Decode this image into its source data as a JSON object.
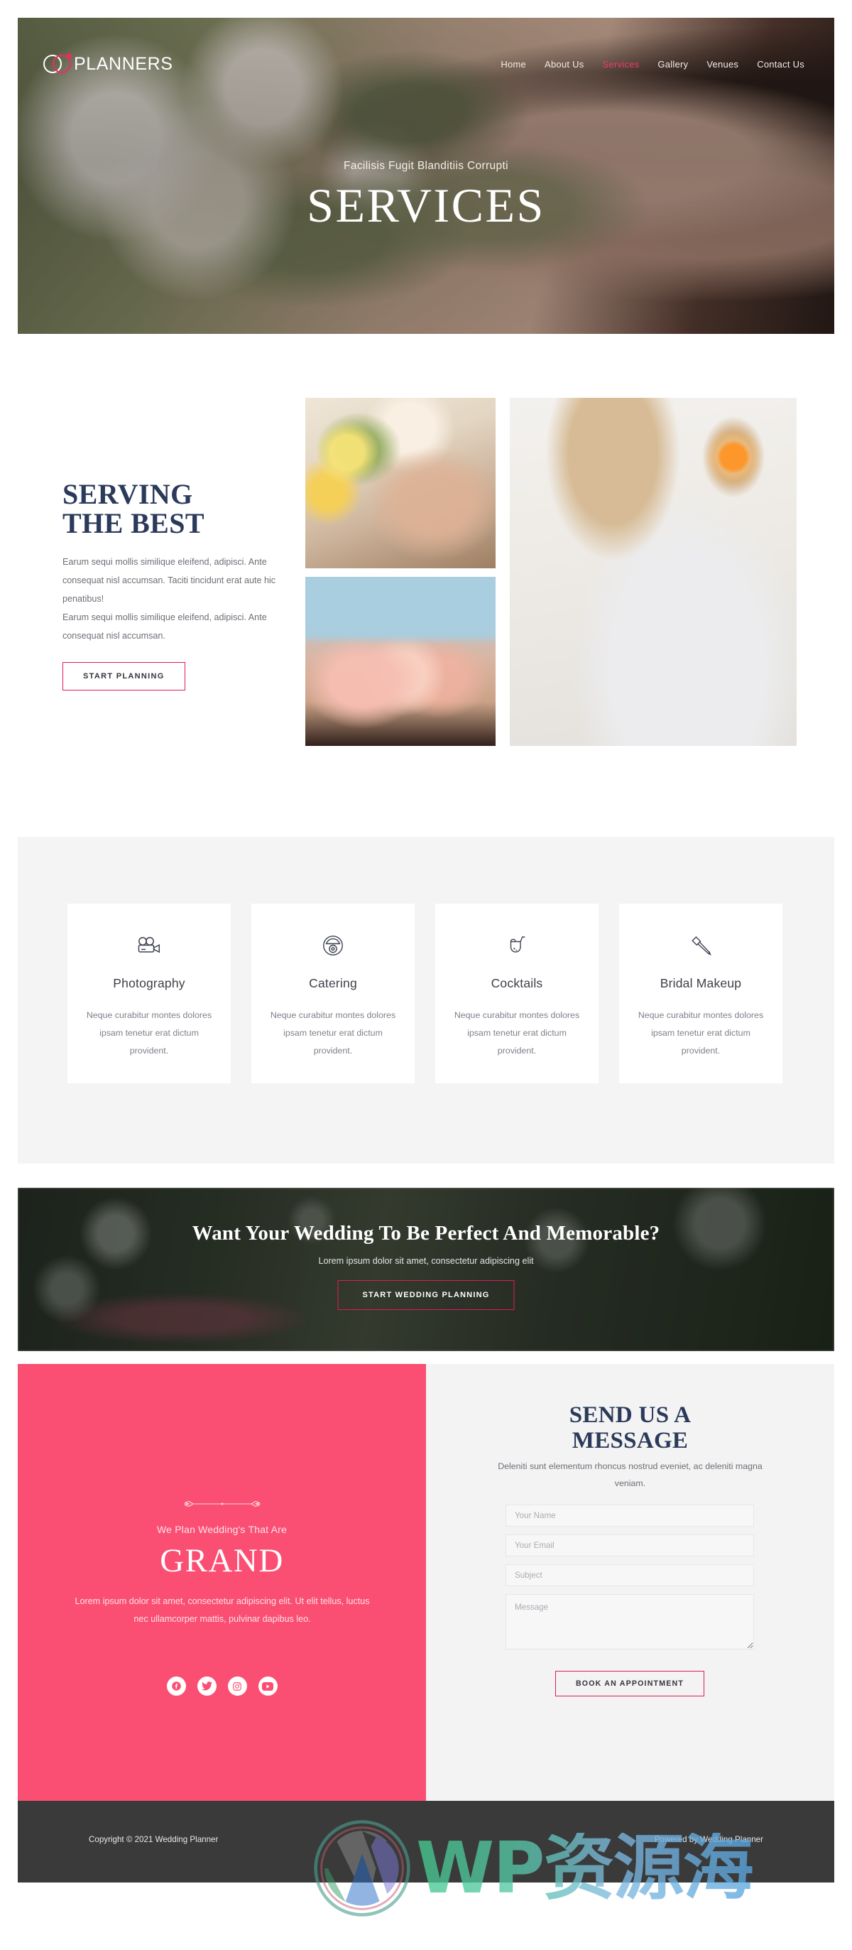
{
  "header": {
    "logo_text": "PLANNERS",
    "nav": [
      {
        "label": "Home",
        "active": false
      },
      {
        "label": "About Us",
        "active": false
      },
      {
        "label": "Services",
        "active": true
      },
      {
        "label": "Gallery",
        "active": false
      },
      {
        "label": "Venues",
        "active": false
      },
      {
        "label": "Contact Us",
        "active": false
      }
    ]
  },
  "hero": {
    "subtitle": "Facilisis Fugit Blanditiis Corrupti",
    "title": "SERVICES"
  },
  "serving": {
    "title_line1": "SERVING",
    "title_line2": "THE BEST",
    "paragraph": "Earum sequi mollis similique eleifend, adipisci. Ante consequat nisl accumsan. Taciti tincidunt erat aute hic penatibus!\nEarum sequi mollis similique eleifend, adipisci. Ante consequat nisl accumsan.",
    "button_label": "START PLANNING"
  },
  "services": {
    "cards": [
      {
        "icon": "video-camera-icon",
        "title": "Photography",
        "description": "Neque curabitur montes dolores ipsam tenetur erat dictum provident."
      },
      {
        "icon": "cloche-food-cover-icon",
        "title": "Catering",
        "description": "Neque curabitur montes dolores ipsam tenetur erat dictum provident."
      },
      {
        "icon": "cocktail-glass-icon",
        "title": "Cocktails",
        "description": "Neque curabitur montes dolores ipsam tenetur erat dictum provident."
      },
      {
        "icon": "makeup-brush-icon",
        "title": "Bridal Makeup",
        "description": "Neque curabitur montes dolores ipsam tenetur erat dictum provident."
      }
    ]
  },
  "cta": {
    "title": "Want Your Wedding To Be Perfect And Memorable?",
    "subtitle": "Lorem ipsum dolor sit amet, consectetur adipiscing elit",
    "button_label": "START WEDDING PLANNING"
  },
  "grand": {
    "kicker": "We Plan Wedding's That Are",
    "title": "GRAND",
    "paragraph": "Lorem ipsum dolor sit amet, consectetur adipiscing elit. Ut elit tellus, luctus nec ullamcorper mattis, pulvinar dapibus leo.",
    "socials": [
      {
        "name": "facebook-icon",
        "label": "Facebook"
      },
      {
        "name": "twitter-icon",
        "label": "Twitter"
      },
      {
        "name": "instagram-icon",
        "label": "Instagram"
      },
      {
        "name": "youtube-icon",
        "label": "YouTube"
      }
    ]
  },
  "contact_form": {
    "title_line1": "SEND US A",
    "title_line2": "MESSAGE",
    "subtitle": "Deleniti sunt elementum rhoncus nostrud eveniet, ac deleniti magna veniam.",
    "fields": [
      {
        "name": "name",
        "placeholder": "Your Name",
        "value": ""
      },
      {
        "name": "email",
        "placeholder": "Your Email",
        "value": ""
      },
      {
        "name": "subject",
        "placeholder": "Subject",
        "value": ""
      },
      {
        "name": "message",
        "placeholder": "Message",
        "value": ""
      }
    ],
    "button_label": "BOOK AN APPOINTMENT"
  },
  "footer": {
    "copyright": "Copyright © 2021 Wedding Planner",
    "powered_by": "Powered by Wedding Planner"
  },
  "watermark": {
    "text": "WP资源海",
    "logo": "wordpress-logo-icon"
  },
  "colors": {
    "accent_pink": "#e21b55",
    "brand_pink": "#fa4f73",
    "nav_active": "#ef3b6b",
    "navy": "#2b3a5b",
    "band_grey": "#f4f4f4",
    "form_grey": "#f3f3f3",
    "footer_dark": "#3a3a3a"
  }
}
